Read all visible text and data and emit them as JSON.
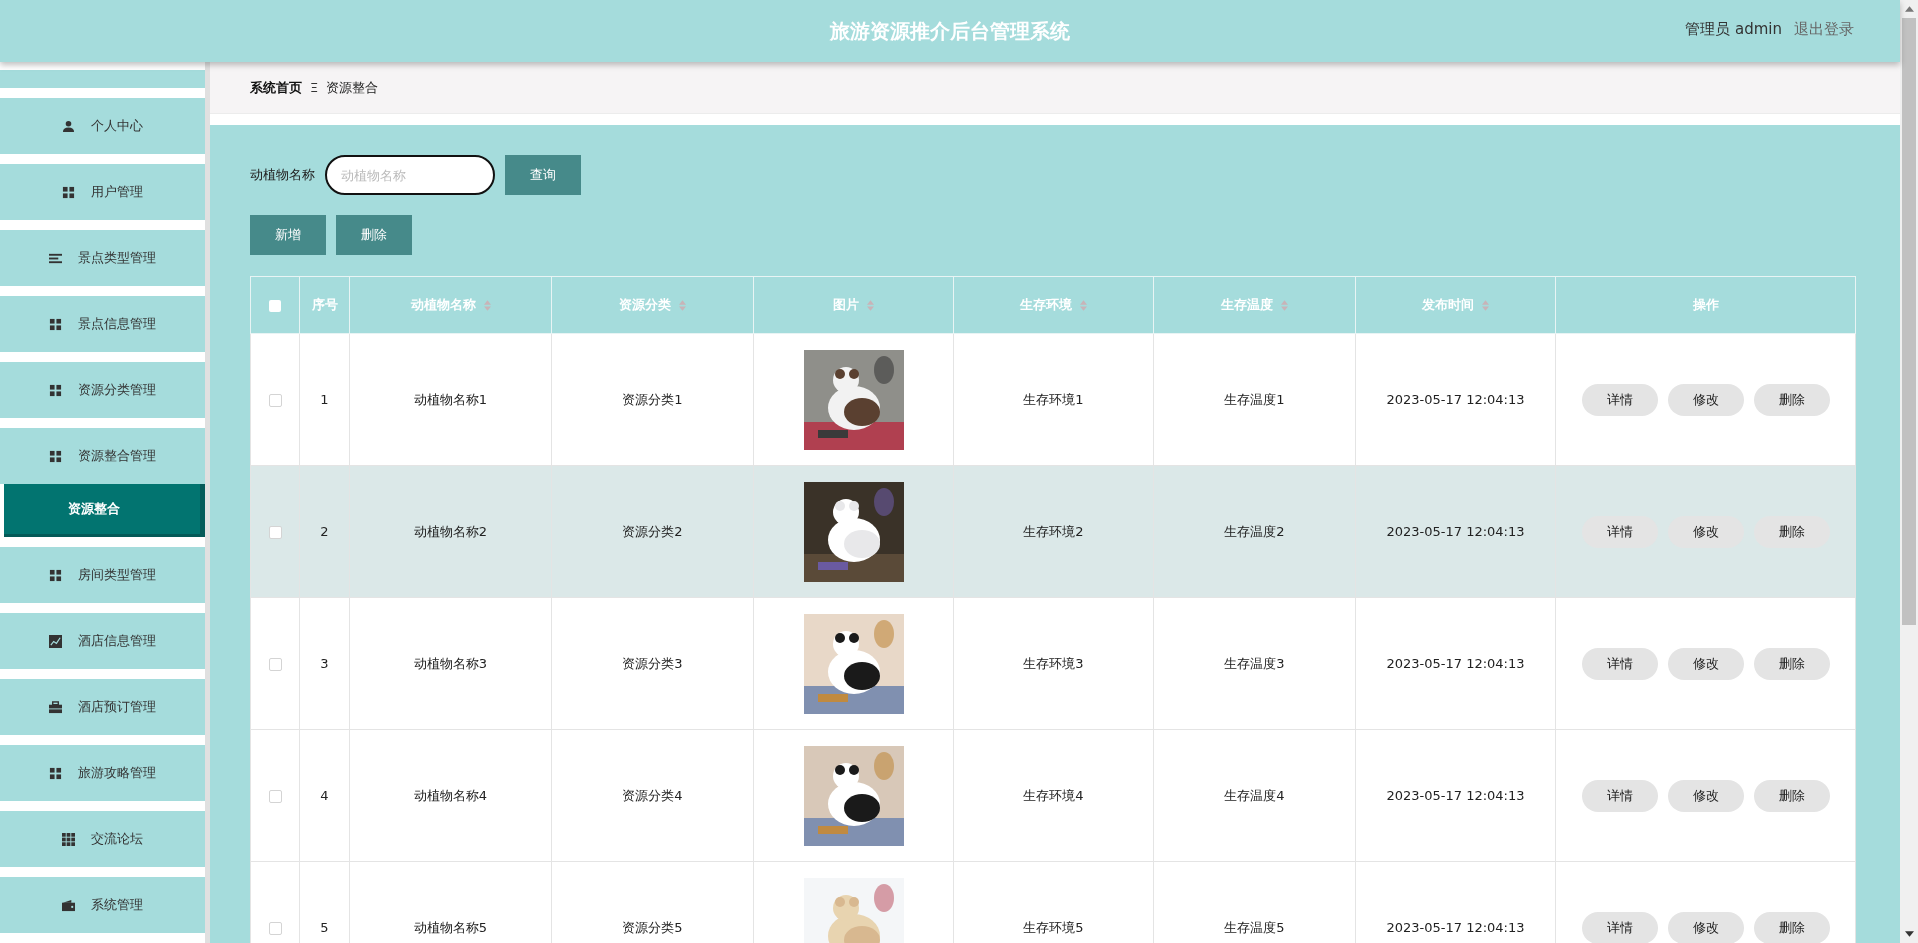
{
  "header": {
    "title": "旅游资源推介后台管理系统",
    "user": "管理员 admin",
    "logout": "退出登录"
  },
  "sidebar": {
    "items": [
      {
        "label": "个人中心",
        "selected": false
      },
      {
        "label": "用户管理",
        "selected": false
      },
      {
        "label": "景点类型管理",
        "selected": false
      },
      {
        "label": "景点信息管理",
        "selected": false
      },
      {
        "label": "资源分类管理",
        "selected": false
      },
      {
        "label": "资源整合管理",
        "selected": false,
        "children": [
          {
            "label": "资源整合",
            "selected": true
          }
        ]
      },
      {
        "label": "房间类型管理",
        "selected": false
      },
      {
        "label": "酒店信息管理",
        "selected": false
      },
      {
        "label": "酒店预订管理",
        "selected": false
      },
      {
        "label": "旅游攻略管理",
        "selected": false
      },
      {
        "label": "交流论坛",
        "selected": false
      },
      {
        "label": "系统管理",
        "selected": false
      }
    ]
  },
  "breadcrumb": {
    "home": "系统首页",
    "separator": "Ξ",
    "current": "资源整合"
  },
  "search": {
    "label": "动植物名称",
    "placeholder": "动植物名称",
    "button": "查询"
  },
  "actions": [
    "新增",
    "删除"
  ],
  "table": {
    "select_all": {
      "checked": false
    },
    "columns": [
      {
        "label": "序号",
        "kind": "text",
        "sortable": false
      },
      {
        "label": "动植物名称",
        "kind": "text",
        "sortable": true
      },
      {
        "label": "资源分类",
        "kind": "text",
        "sortable": true
      },
      {
        "label": "图片",
        "kind": "picture",
        "sortable": true
      },
      {
        "label": "生存环境",
        "kind": "text",
        "sortable": true
      },
      {
        "label": "生存温度",
        "kind": "text",
        "sortable": true
      },
      {
        "label": "发布时间",
        "kind": "text",
        "sortable": true
      },
      {
        "label": "操作",
        "kind": "actions",
        "sortable": false
      }
    ],
    "rows": [
      {
        "checked": false,
        "highlighted": false,
        "cells": [
          "1",
          "动植物名称1",
          "资源分类1",
          {
            "kind": "picture"
          },
          "生存环境1",
          "生存温度1",
          "2023-05-17 12:04:13",
          {
            "buttons": [
              "详情",
              "修改",
              "删除"
            ]
          }
        ]
      },
      {
        "checked": false,
        "highlighted": true,
        "cells": [
          "2",
          "动植物名称2",
          "资源分类2",
          {
            "kind": "picture"
          },
          "生存环境2",
          "生存温度2",
          "2023-05-17 12:04:13",
          {
            "buttons": [
              "详情",
              "修改",
              "删除"
            ]
          }
        ]
      },
      {
        "checked": false,
        "highlighted": false,
        "cells": [
          "3",
          "动植物名称3",
          "资源分类3",
          {
            "kind": "picture"
          },
          "生存环境3",
          "生存温度3",
          "2023-05-17 12:04:13",
          {
            "buttons": [
              "详情",
              "修改",
              "删除"
            ]
          }
        ]
      },
      {
        "checked": false,
        "highlighted": false,
        "cells": [
          "4",
          "动植物名称4",
          "资源分类4",
          {
            "kind": "picture"
          },
          "生存环境4",
          "生存温度4",
          "2023-05-17 12:04:13",
          {
            "buttons": [
              "详情",
              "修改",
              "删除"
            ]
          }
        ]
      },
      {
        "checked": false,
        "highlighted": false,
        "cells": [
          "5",
          "动植物名称5",
          "资源分类5",
          {
            "kind": "picture"
          },
          "生存环境5",
          "生存温度5",
          "2023-05-17 12:04:13",
          {
            "buttons": [
              "详情",
              "修改",
              "删除"
            ]
          }
        ]
      }
    ]
  }
}
